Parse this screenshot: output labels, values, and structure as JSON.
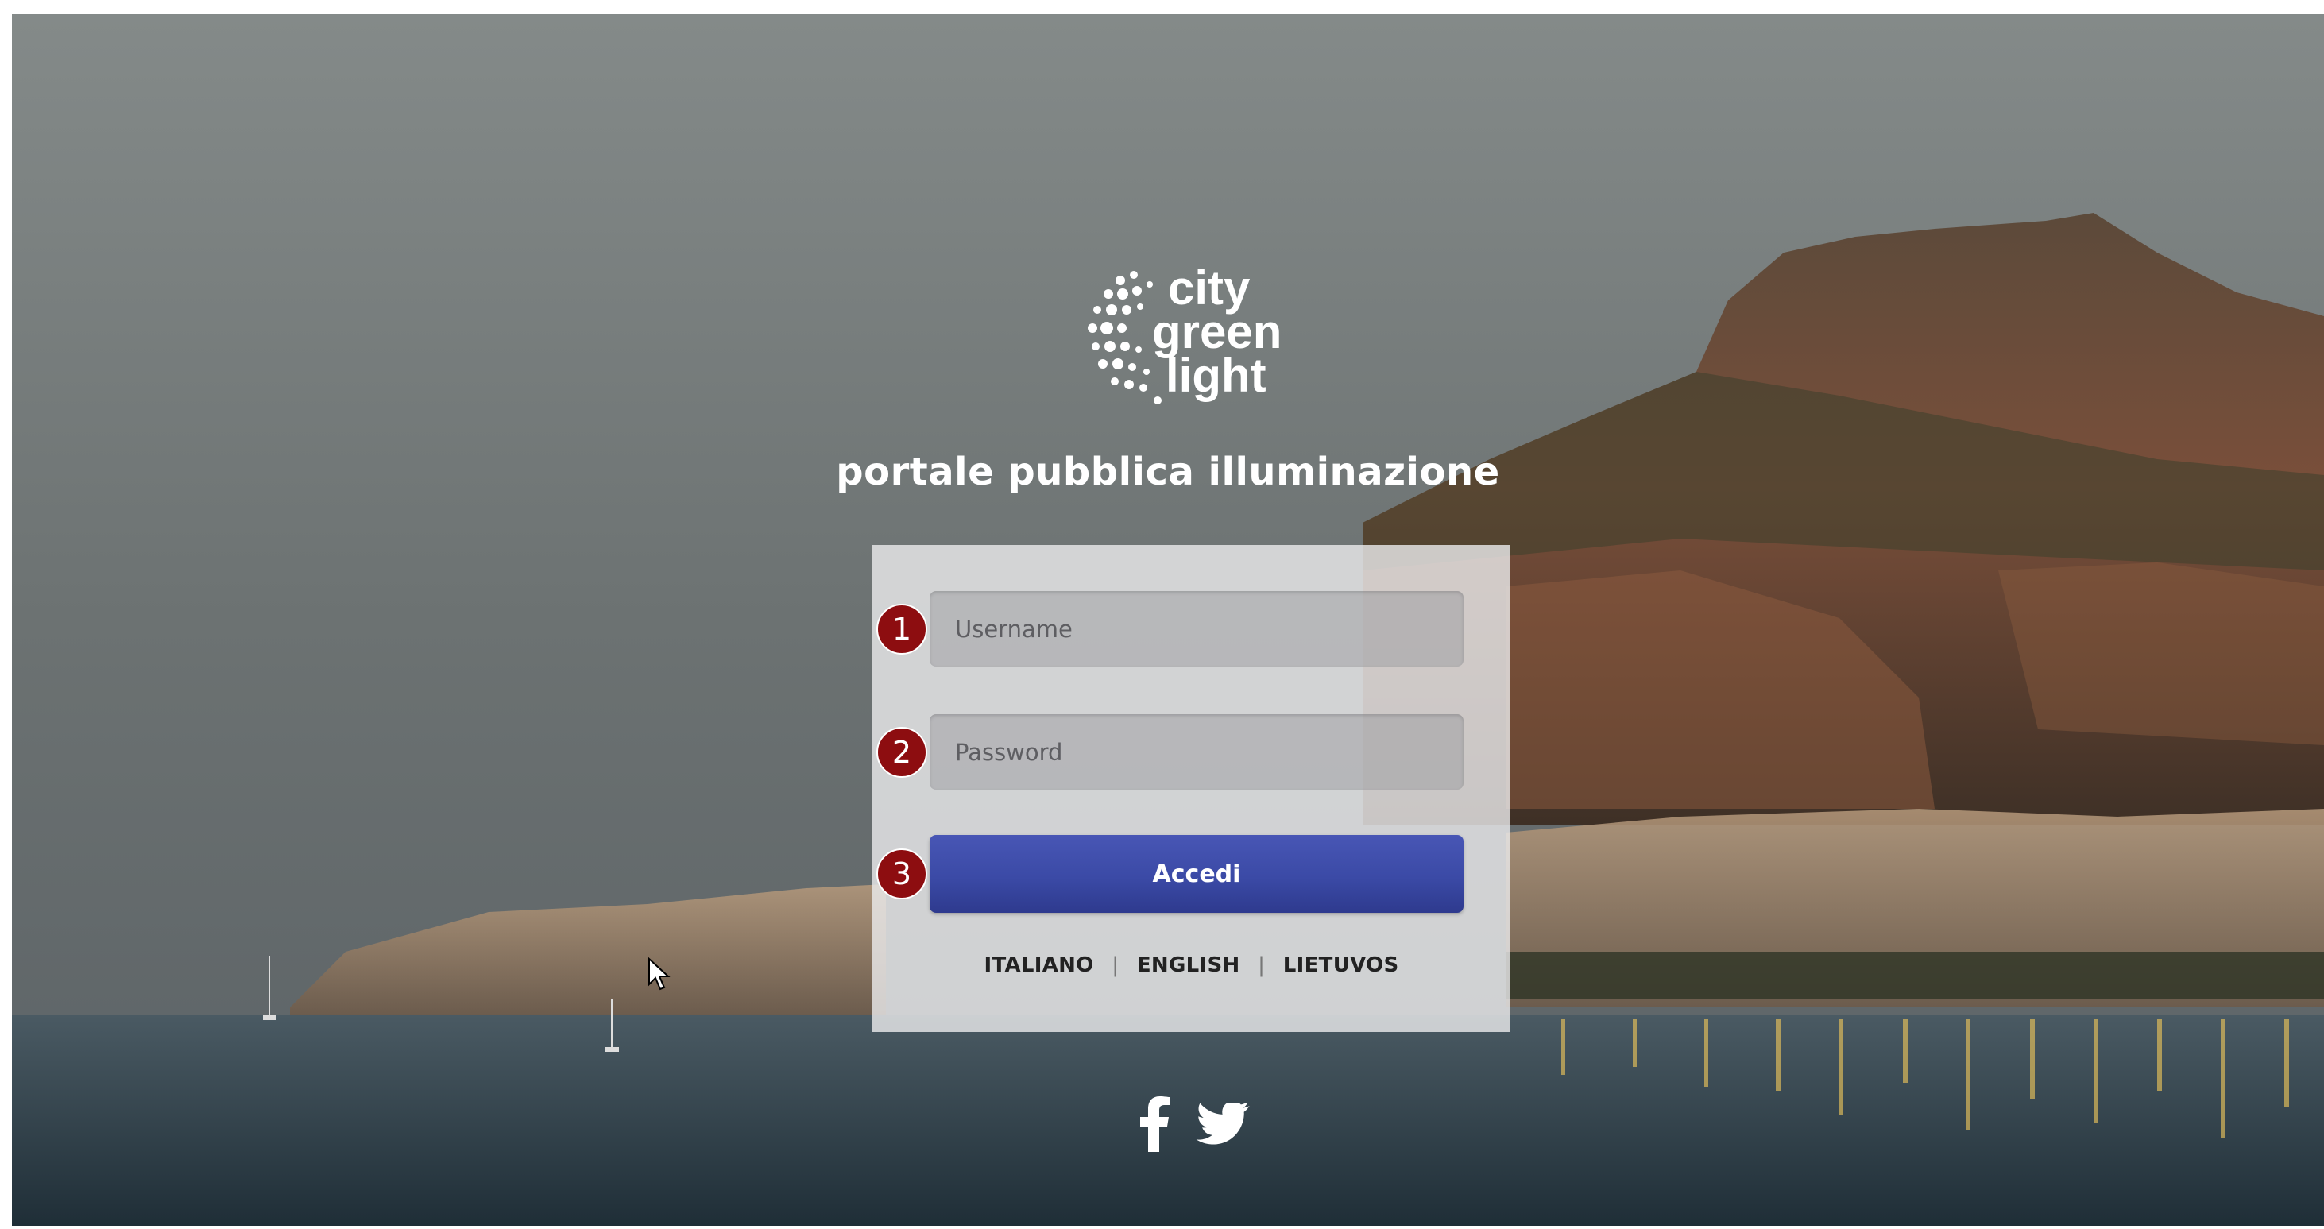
{
  "brand": {
    "logo_lines": [
      "city",
      "green",
      "light"
    ],
    "title": "portale pubblica illuminazione"
  },
  "login": {
    "username_placeholder": "Username",
    "password_placeholder": "Password",
    "submit_label": "Accedi",
    "steps": [
      "1",
      "2",
      "3"
    ]
  },
  "languages": {
    "items": [
      "ITALIANO",
      "ENGLISH",
      "LIETUVOS"
    ],
    "separator": "|"
  },
  "social": {
    "icons": [
      "facebook-icon",
      "twitter-icon"
    ]
  },
  "colors": {
    "button": "#3b4aa6",
    "step_badge": "#8d0d10",
    "panel": "#ececee"
  }
}
